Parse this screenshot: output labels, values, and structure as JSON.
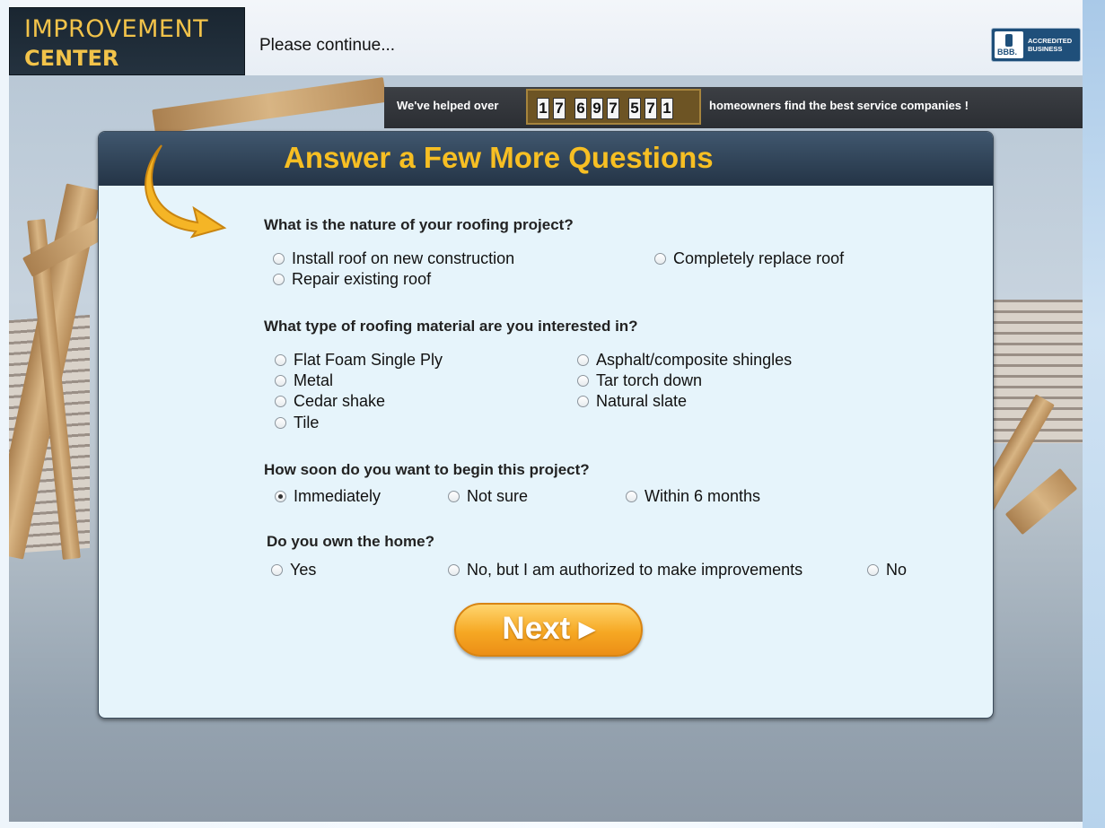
{
  "header": {
    "logo_line1": "IMPROVEMENT",
    "logo_line2": "CENTER",
    "continue_text": "Please continue...",
    "bbb_seal": "BBB.",
    "bbb_line1": "ACCREDITED",
    "bbb_line2": "BUSINESS"
  },
  "counter": {
    "prefix": "We've helped over",
    "digits": [
      "1",
      "7",
      "6",
      "9",
      "7",
      "5",
      "7",
      "1"
    ],
    "suffix": "homeowners find the best service companies !"
  },
  "form": {
    "title": "Answer a Few More Questions",
    "q1": {
      "label": "What is the nature of your roofing project?",
      "options": [
        "Install roof on new construction",
        "Completely replace roof",
        "Repair existing roof"
      ]
    },
    "q2": {
      "label": "What type of roofing material are you interested in?",
      "options": [
        "Flat Foam Single Ply",
        "Asphalt/composite shingles",
        "Metal",
        "Tar torch down",
        "Cedar shake",
        "Natural slate",
        "Tile"
      ]
    },
    "q3": {
      "label": "How soon do you want to begin this project?",
      "options": [
        "Immediately",
        "Not sure",
        "Within 6 months"
      ],
      "selected": "Immediately"
    },
    "q4": {
      "label": "Do you own the home?",
      "options": [
        "Yes",
        "No, but I am authorized to make improvements",
        "No"
      ]
    },
    "next_label": "Next ▸"
  },
  "colors": {
    "title_accent": "#f7bf23",
    "logo_accent": "#f2c34a",
    "next_button": "#f6a823"
  }
}
